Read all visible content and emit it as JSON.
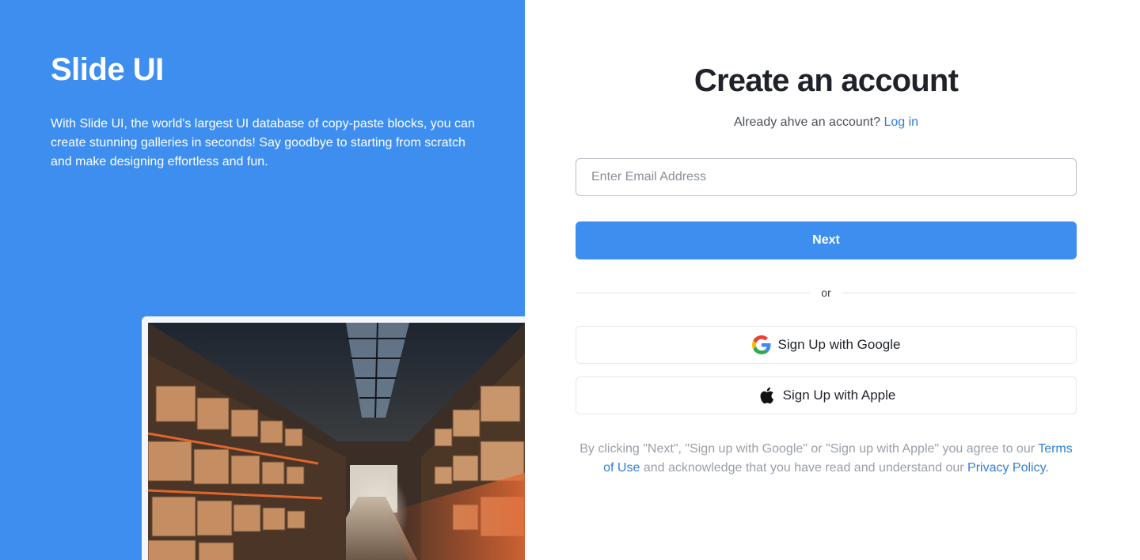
{
  "brand": {
    "title": "Slide UI",
    "description": "With Slide UI, the world's largest UI database of copy-paste blocks, you can create stunning galleries in seconds! Say goodbye to starting from scratch and make designing effortless and fun."
  },
  "form": {
    "title": "Create an account",
    "login_prompt": "Already ahve an account?",
    "login_link": "Log in",
    "email_placeholder": "Enter Email Address",
    "next_label": "Next",
    "divider_label": "or",
    "google_label": "Sign Up with Google",
    "apple_label": "Sign Up with Apple"
  },
  "terms": {
    "text_before": "By clicking \"Next\", \"Sign up with Google\" or \"Sign up with Apple\" you agree to our",
    "terms_link": "Terms of Use",
    "text_middle": "and acknowledge that you have read and understand our",
    "privacy_link": "Privacy Policy."
  },
  "icons": {
    "google": "google-icon",
    "apple": "apple-icon"
  },
  "colors": {
    "brand_blue": "#3e8ef0",
    "link_blue": "#2f80d8",
    "heading": "#1f2329"
  }
}
